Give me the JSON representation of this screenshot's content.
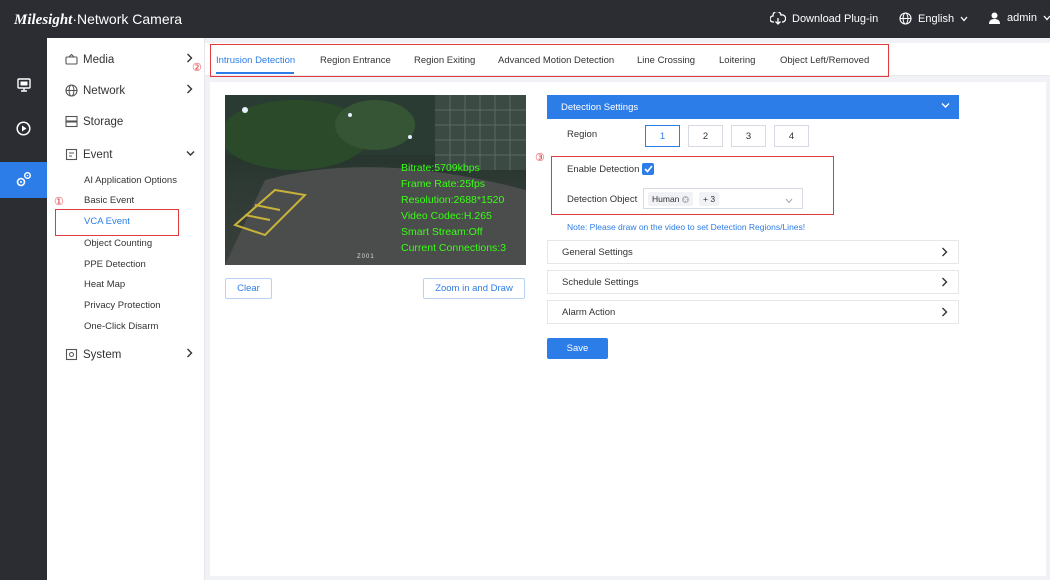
{
  "header": {
    "brand_logo": "Milesight",
    "brand_product": "·Network Camera",
    "download_label": "Download Plug-in",
    "language_label": "English",
    "user_label": "admin"
  },
  "rail": [
    "monitor-icon",
    "playback-icon",
    "settings-icon"
  ],
  "sidebar": {
    "media": "Media",
    "network": "Network",
    "storage": "Storage",
    "event": "Event",
    "event_items": [
      "AI Application Options",
      "Basic Event",
      "VCA Event",
      "Object Counting",
      "PPE Detection",
      "Heat Map",
      "Privacy Protection",
      "One-Click Disarm"
    ],
    "system": "System"
  },
  "markers": {
    "one": "①",
    "two": "②",
    "three": "③"
  },
  "tabs": [
    "Intrusion Detection",
    "Region Entrance",
    "Region Exiting",
    "Advanced Motion Detection",
    "Line Crossing",
    "Loitering",
    "Object Left/Removed"
  ],
  "video": {
    "osd": [
      "Bitrate:5709kbps",
      "Frame Rate:25fps",
      "Resolution:2688*1520",
      "Video Codec:H.265",
      "Smart Stream:Off",
      "Current Connections:3"
    ],
    "zone_label": "Z001"
  },
  "buttons": {
    "clear": "Clear",
    "zoom_draw": "Zoom in and Draw",
    "save": "Save"
  },
  "detection": {
    "header": "Detection Settings",
    "region_label": "Region",
    "regions": [
      "1",
      "2",
      "3",
      "4"
    ],
    "enable_label": "Enable Detection",
    "enable_checked": true,
    "object_label": "Detection Object",
    "object_tags": [
      "Human",
      "+ 3"
    ],
    "note": "Note: Please draw on the video to set Detection Regions/Lines!"
  },
  "sections": [
    "General Settings",
    "Schedule Settings",
    "Alarm Action"
  ],
  "colors": {
    "accent": "#2d7de8",
    "topbar": "#2b2d33",
    "highlight": "#e0393e",
    "osd": "#39ff14"
  }
}
